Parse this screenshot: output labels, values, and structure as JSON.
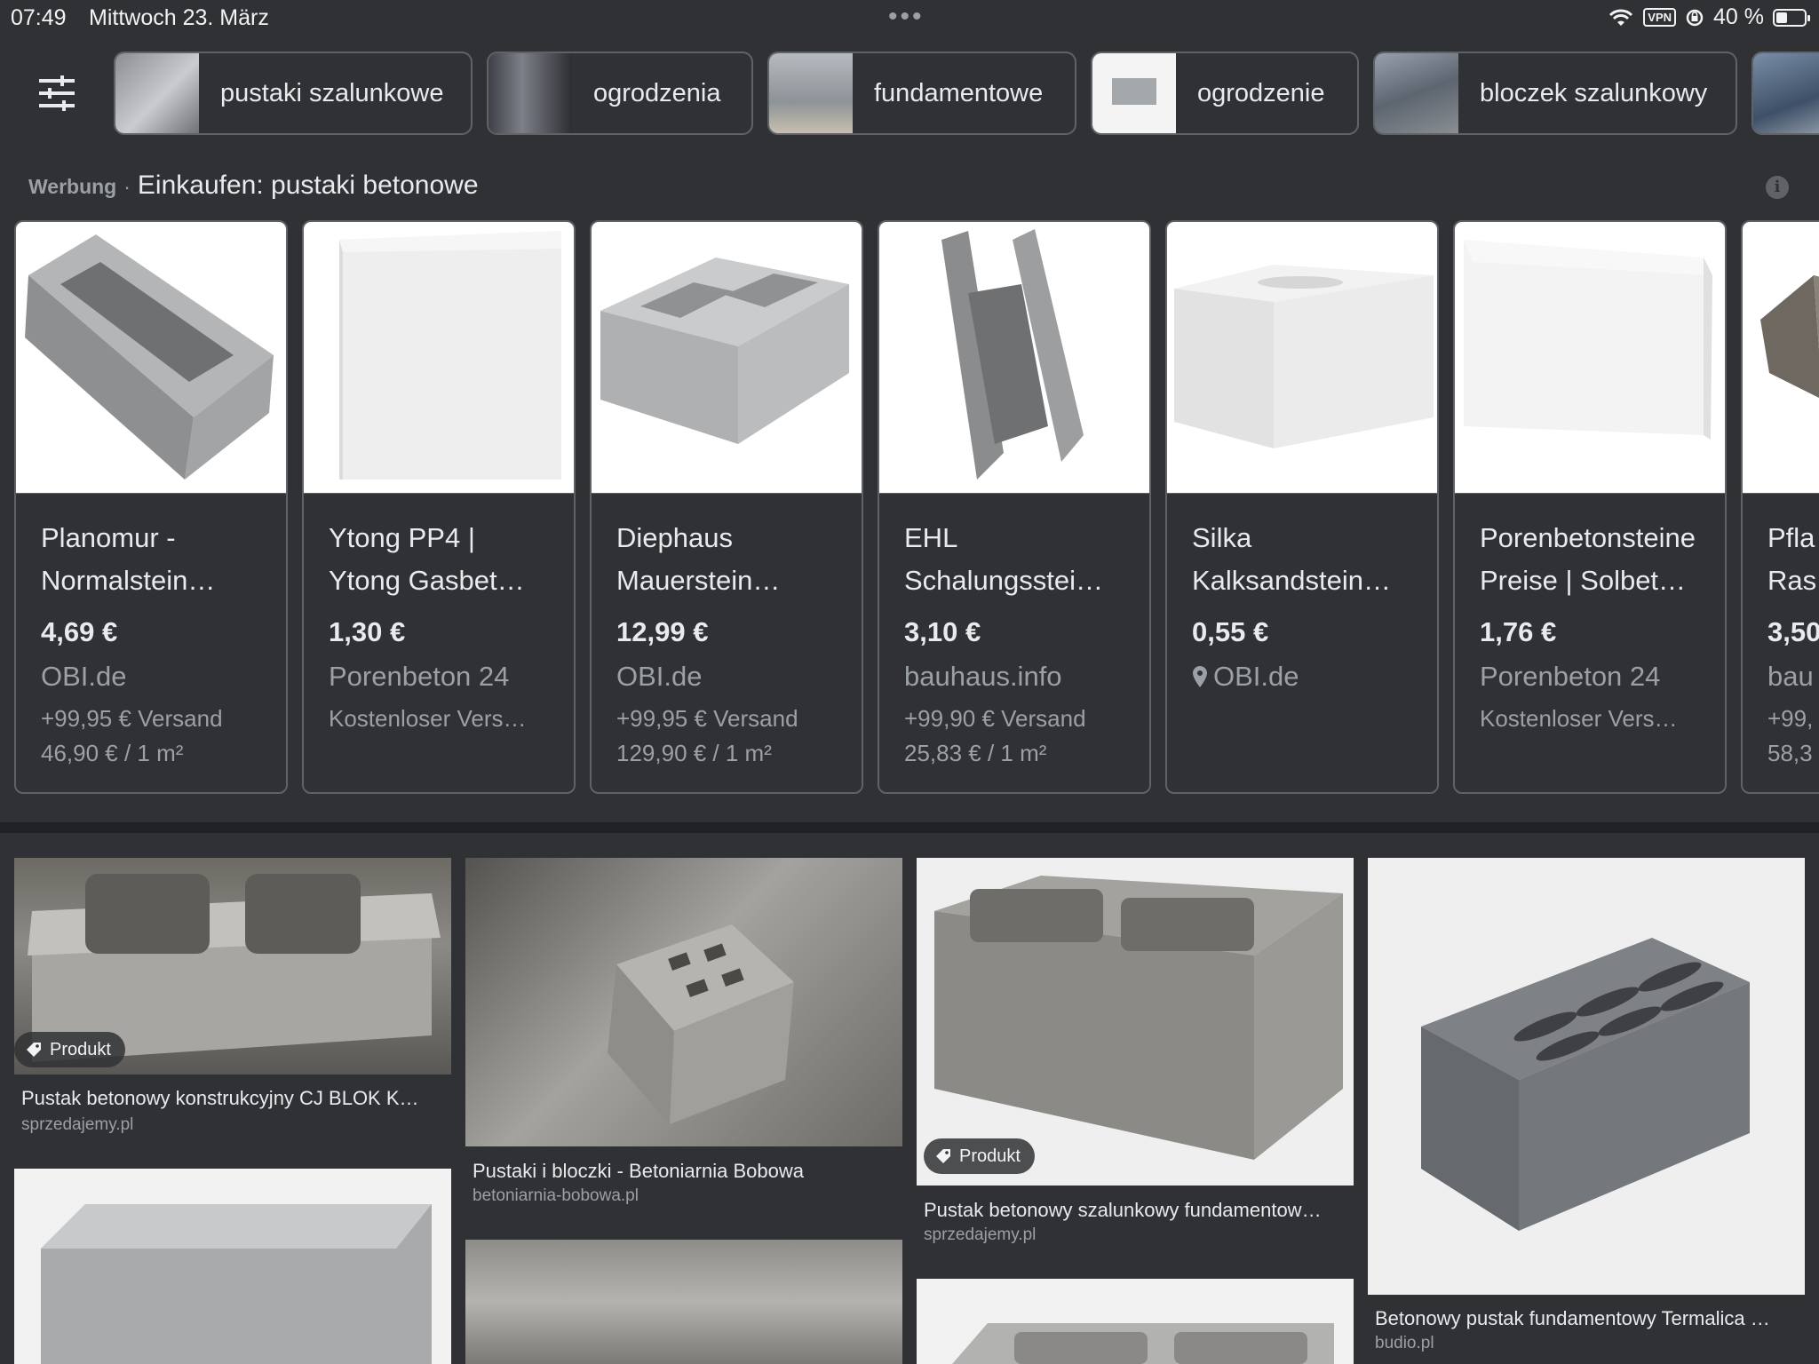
{
  "status_bar": {
    "time": "07:49",
    "date": "Mittwoch 23. März",
    "vpn": "VPN",
    "battery": "40 %",
    "battery_level": 0.4
  },
  "chips": [
    {
      "label": "pustaki szalunkowe"
    },
    {
      "label": "ogrodzenia"
    },
    {
      "label": "fundamentowe"
    },
    {
      "label": "ogrodzenie"
    },
    {
      "label": "bloczek szalunkowy"
    }
  ],
  "ads": {
    "tag": "Werbung",
    "separator": "·",
    "title": "Einkaufen: pustaki betonowe",
    "info": "i",
    "products": [
      {
        "title1": "Planomur -",
        "title2": "Normalstein…",
        "price": "4,69 €",
        "store": "OBI.de",
        "shipping": "+99,95 € Versand",
        "unit_price": "46,90 € / 1 m²"
      },
      {
        "title1": "Ytong PP4 |",
        "title2": "Ytong Gasbet…",
        "price": "1,30 €",
        "store": "Porenbeton 24",
        "shipping": "Kostenloser Vers…",
        "unit_price": ""
      },
      {
        "title1": "Diephaus",
        "title2": "Mauerstein…",
        "price": "12,99 €",
        "store": "OBI.de",
        "shipping": "+99,95 € Versand",
        "unit_price": "129,90 € / 1 m²"
      },
      {
        "title1": "EHL",
        "title2": "Schalungsstei…",
        "price": "3,10 €",
        "store": "bauhaus.info",
        "shipping": "+99,90 € Versand",
        "unit_price": "25,83 € / 1 m²"
      },
      {
        "title1": "Silka",
        "title2": "Kalksandstein…",
        "price": "0,55 €",
        "store": "OBI.de",
        "shipping": "",
        "unit_price": ""
      },
      {
        "title1": "Porenbetonsteine",
        "title2": "Preise | Solbet…",
        "price": "1,76 €",
        "store": "Porenbeton 24",
        "shipping": "Kostenloser Vers…",
        "unit_price": ""
      },
      {
        "title1": "Pfla",
        "title2": "Ras",
        "price": "3,50",
        "store": "bau",
        "shipping": "+99,",
        "unit_price": "58,3"
      }
    ]
  },
  "results": [
    {
      "title": "Pustak betonowy konstrukcyjny CJ BLOK K…",
      "source": "sprzedajemy.pl",
      "badge": "Produkt"
    },
    {
      "title": "Pustaki i bloczki - Betoniarnia Bobowa",
      "source": "betoniarnia-bobowa.pl",
      "badge": ""
    },
    {
      "title": "Pustak betonowy szalunkowy fundamentow…",
      "source": "sprzedajemy.pl",
      "badge": "Produkt"
    },
    {
      "title": "Betonowy pustak fundamentowy Termalica …",
      "source": "budio.pl",
      "badge": ""
    }
  ]
}
